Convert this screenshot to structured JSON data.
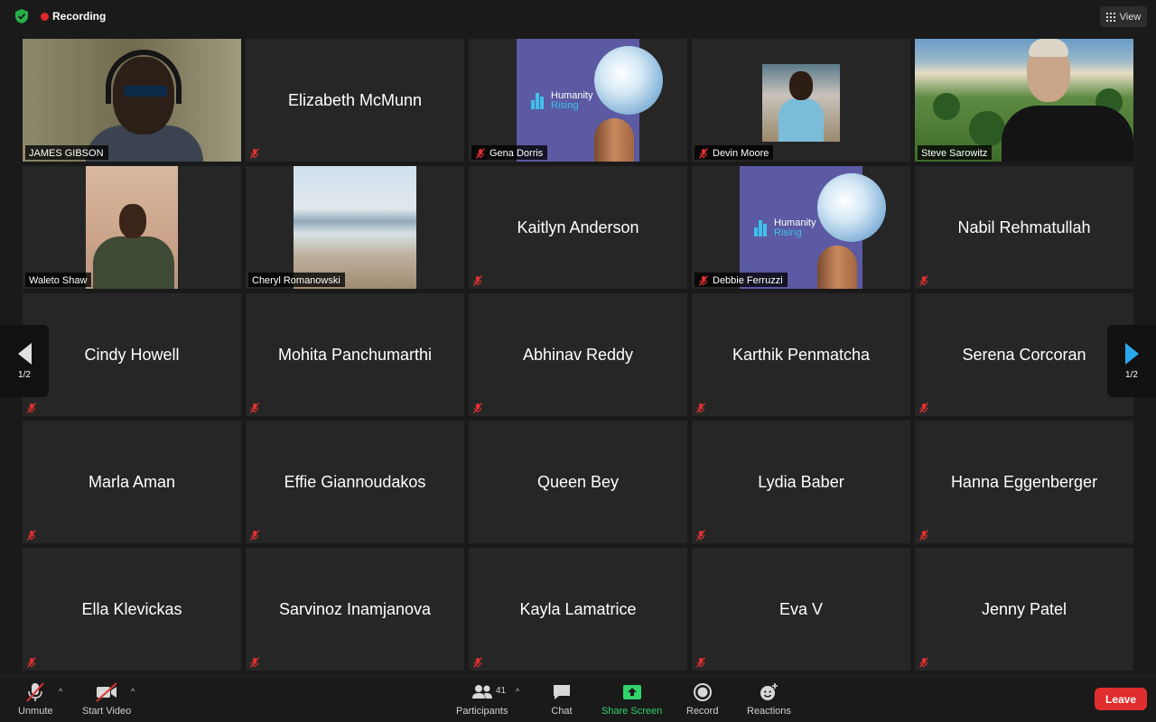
{
  "app": {
    "recording_label": "Recording",
    "view_label": "View"
  },
  "pagination": {
    "left": "1/2",
    "right": "1/2"
  },
  "participants_grid": [
    {
      "name": "JAMES GIBSON",
      "video": "photo-james",
      "active": true,
      "muted": false
    },
    {
      "name": "Elizabeth McMunn",
      "video": null,
      "muted": true
    },
    {
      "name": "Gena Dorris",
      "video": "logo-humanity-rising",
      "muted": true
    },
    {
      "name": "Devin Moore",
      "video": "photo-devin",
      "muted": true
    },
    {
      "name": "Steve Sarowitz",
      "video": "photo-steve",
      "muted": false
    },
    {
      "name": "Waleto Shaw",
      "video": "photo-waleto",
      "muted": false
    },
    {
      "name": "Cheryl Romanowski",
      "video": "photo-beach",
      "muted": false
    },
    {
      "name": "Kaitlyn Anderson",
      "video": null,
      "muted": true
    },
    {
      "name": "Debbie Ferruzzi",
      "video": "logo-humanity-rising",
      "muted": true
    },
    {
      "name": "Nabil Rehmatullah",
      "video": null,
      "muted": true
    },
    {
      "name": "Cindy Howell",
      "video": null,
      "muted": true
    },
    {
      "name": "Mohita Panchumarthi",
      "video": null,
      "muted": true
    },
    {
      "name": "Abhinav Reddy",
      "video": null,
      "muted": true
    },
    {
      "name": "Karthik Penmatcha",
      "video": null,
      "muted": true
    },
    {
      "name": "Serena Corcoran",
      "video": null,
      "muted": true
    },
    {
      "name": "Marla Aman",
      "video": null,
      "muted": true
    },
    {
      "name": "Effie Giannoudakos",
      "video": null,
      "muted": true
    },
    {
      "name": "Queen Bey",
      "video": null,
      "muted": false
    },
    {
      "name": "Lydia Baber",
      "video": null,
      "muted": true
    },
    {
      "name": "Hanna Eggenberger",
      "video": null,
      "muted": true
    },
    {
      "name": "Ella Klevickas",
      "video": null,
      "muted": true
    },
    {
      "name": "Sarvinoz Inamjanova",
      "video": null,
      "muted": true
    },
    {
      "name": "Kayla Lamatrice",
      "video": null,
      "muted": true
    },
    {
      "name": "Eva V",
      "video": null,
      "muted": true
    },
    {
      "name": "Jenny Patel",
      "video": null,
      "muted": true
    }
  ],
  "logo": {
    "line1": "Humanity",
    "line2": "Rising"
  },
  "toolbar": {
    "unmute": "Unmute",
    "start_video": "Start Video",
    "participants": "Participants",
    "participants_count": "41",
    "chat": "Chat",
    "share_screen": "Share Screen",
    "record": "Record",
    "reactions": "Reactions",
    "leave": "Leave"
  },
  "colors": {
    "recording": "#e02828",
    "active_speaker": "#e8f05a",
    "share_screen": "#31d36b",
    "leave": "#e02d2d",
    "page_arrow": "#2aa8ee",
    "muted_icon": "#e03030"
  }
}
